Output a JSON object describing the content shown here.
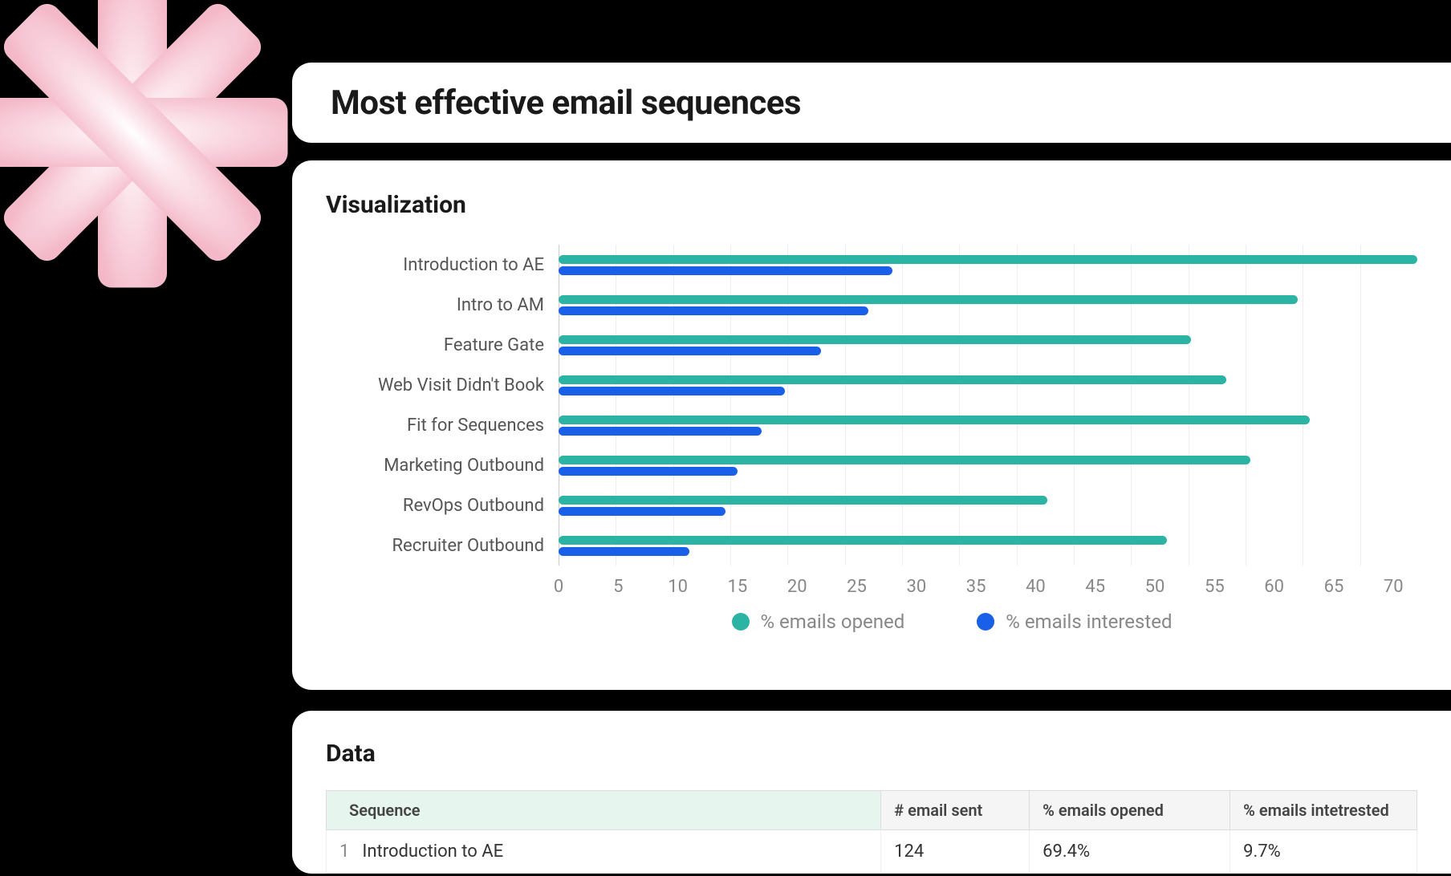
{
  "title": "Most effective email sequences",
  "visualization": {
    "heading": "Visualization"
  },
  "data_section": {
    "heading": "Data",
    "columns": [
      "Sequence",
      "# email sent",
      "% emails opened",
      "% emails intetrested"
    ],
    "rows": [
      {
        "n": "1",
        "sequence": "Introduction to AE",
        "sent": "124",
        "opened": "69.4%",
        "interested": "9.7%"
      }
    ]
  },
  "legend": {
    "opened": "% emails opened",
    "interested": "% emails interested"
  },
  "chart_data": {
    "type": "bar",
    "orientation": "horizontal",
    "title": "Most effective email sequences — Visualization",
    "xlabel": "",
    "ylabel": "",
    "xlim": [
      0,
      72
    ],
    "x_ticks": [
      0,
      5,
      10,
      15,
      20,
      25,
      30,
      35,
      40,
      45,
      50,
      55,
      60,
      65,
      70
    ],
    "categories": [
      "Introduction to AE",
      "Intro to AM",
      "Feature Gate",
      "Web Visit Didn't Book",
      "Fit for Sequences",
      "Marketing Outbound",
      "RevOps Outbound",
      "Recruiter Outbound"
    ],
    "series": [
      {
        "name": "% emails opened",
        "color": "#2BB3A3",
        "values": [
          72,
          62,
          53,
          56,
          63,
          58,
          41,
          51
        ]
      },
      {
        "name": "% emails interested",
        "color": "#1A5FE8",
        "values": [
          28,
          26,
          22,
          19,
          17,
          15,
          14,
          11
        ]
      }
    ],
    "legend_position": "bottom"
  }
}
